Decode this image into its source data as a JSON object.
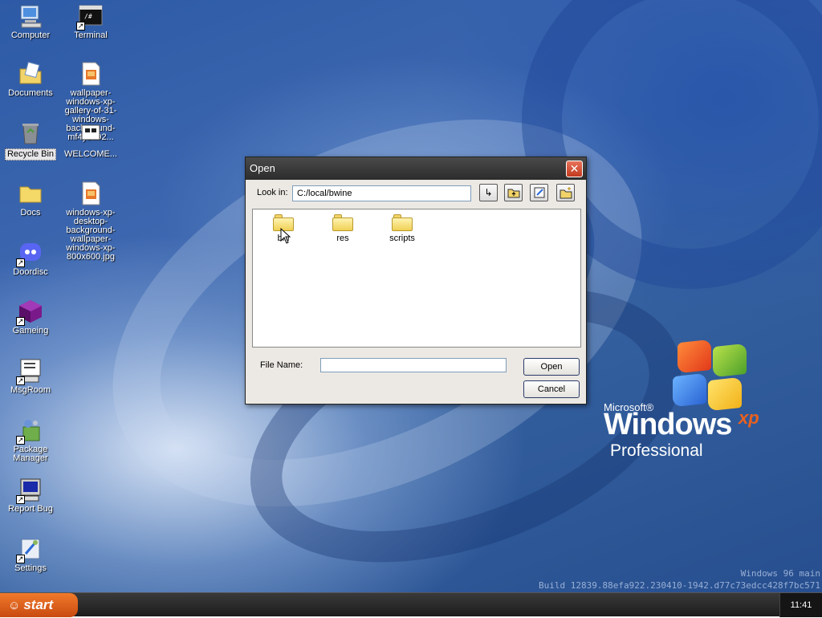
{
  "desktop": {
    "icons": [
      {
        "label": "Computer"
      },
      {
        "label": "Terminal"
      },
      {
        "label": "Documents"
      },
      {
        "label": "wallpaper-windows-xp-gallery-of-31-windows-background-mf4y2a92..."
      },
      {
        "label": "Recycle Bin"
      },
      {
        "label": "WELCOME..."
      },
      {
        "label": "Docs"
      },
      {
        "label": "windows-xp-desktop-background-wallpaper-windows-xp-800x600.jpg"
      },
      {
        "label": "Doordisc"
      },
      {
        "label": "Gameing"
      },
      {
        "label": "MsgRoom"
      },
      {
        "label": "Package Manager"
      },
      {
        "label": "Report Bug"
      },
      {
        "label": "Settings"
      }
    ],
    "logo": {
      "microsoft": "Microsoft®",
      "windows": "Windows",
      "xp": "xp",
      "edition": "Professional"
    },
    "build_line1": "Windows 96 main",
    "build_line2": "Build 12839.88efa922.230410-1942.d77c73edcc428f7bc571"
  },
  "dialog": {
    "title": "Open",
    "look_in_label": "Look in:",
    "look_in_path": "C:/local/bwine",
    "toolbar": [
      "go-icon",
      "up-folder-icon",
      "edit-icon",
      "new-folder-icon"
    ],
    "files": [
      {
        "name": "bin",
        "type": "folder"
      },
      {
        "name": "res",
        "type": "folder"
      },
      {
        "name": "scripts",
        "type": "folder"
      }
    ],
    "filename_label": "File Name:",
    "filename_value": "",
    "open_label": "Open",
    "cancel_label": "Cancel"
  },
  "taskbar": {
    "start_label": "start",
    "clock": "11:41"
  },
  "colors": {
    "title_bar": "#2c2c2c",
    "close_button": "#c2391f",
    "start_button": "#e0621e",
    "desktop": "#3a64ac"
  }
}
